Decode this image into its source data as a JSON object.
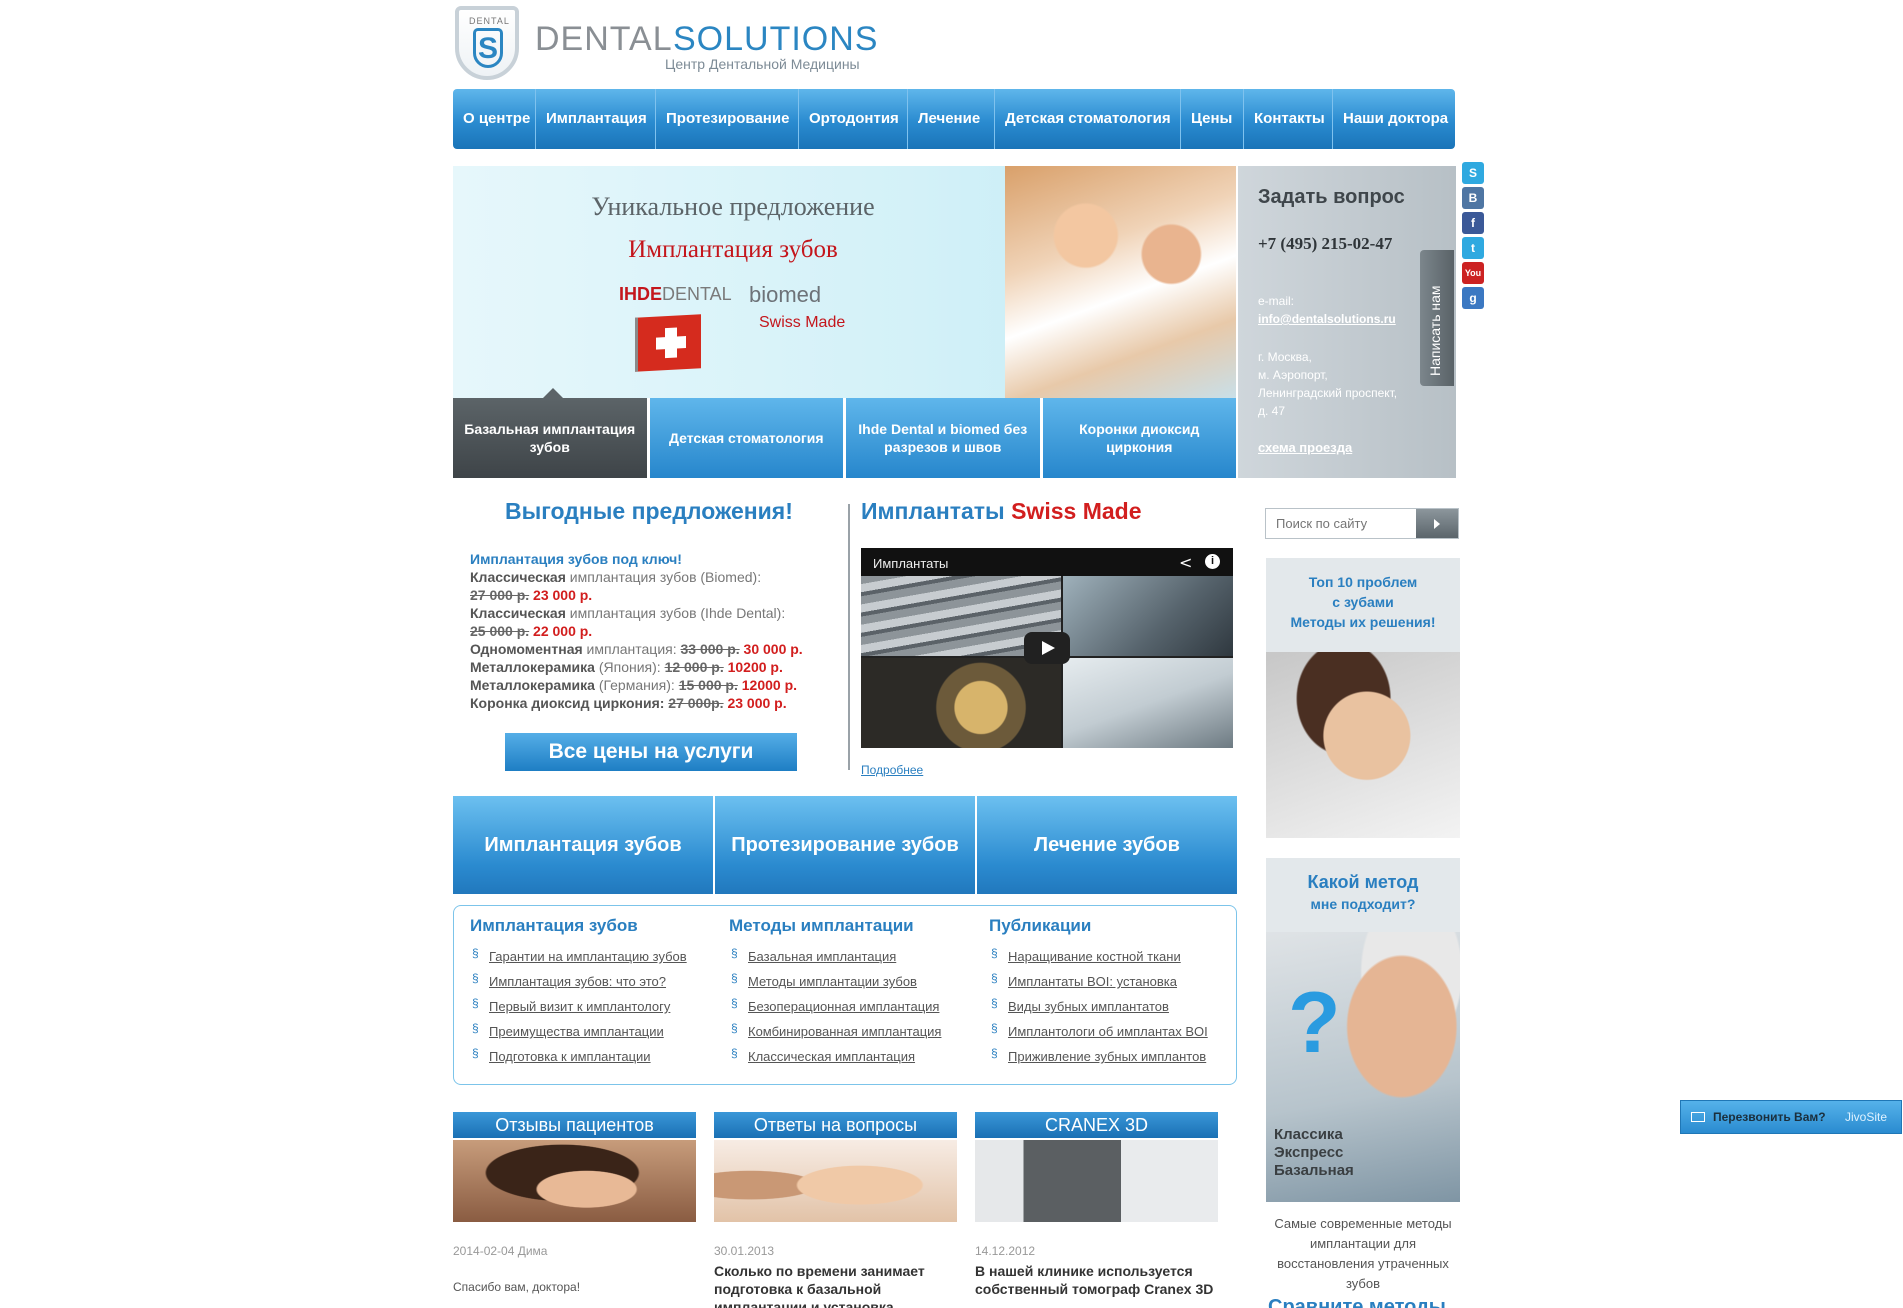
{
  "logo": {
    "small": "DENTAL",
    "letter": "S",
    "word1": "DENTAL",
    "word2": "SOLUTIONS",
    "tagline": "Центр Дентальной Медицины"
  },
  "nav": [
    "О центре",
    "Имплантация",
    "Протезирование",
    "Ортодонтия",
    "Лечение",
    "Детская стоматология",
    "Цены",
    "Контакты",
    "Наши доктора"
  ],
  "hero": {
    "headline": "Уникальное предложение",
    "subheadline": "Имплантация зубов",
    "brand1_a": "IHDE",
    "brand1_b": "DENTAL",
    "brand2": "biomed",
    "swiss": "Swiss Made",
    "tabs": [
      "Базальная имплантация зубов",
      "Детская стоматология",
      "Ihde Dental и biomed без разрезов и швов",
      "Коронки диоксид циркония"
    ]
  },
  "contact": {
    "title": "Задать вопрос",
    "phone": "+7 (495) 215-02-47",
    "email_label": "e-mail:",
    "email": "info@dentalsolutions.ru",
    "address": "г. Москва,\nм. Аэропорт,\nЛенинградский проспект,\nд. 47",
    "map_link": "схема проезда",
    "write_us": "Написать нам"
  },
  "social": [
    {
      "name": "skype-icon",
      "glyph": "S",
      "color": "#2fa9e0"
    },
    {
      "name": "vk-icon",
      "glyph": "В",
      "color": "#4f76a3"
    },
    {
      "name": "facebook-icon",
      "glyph": "f",
      "color": "#3b5998"
    },
    {
      "name": "twitter-icon",
      "glyph": "t",
      "color": "#2fa9e0"
    },
    {
      "name": "youtube-icon",
      "glyph": "You",
      "color": "#cc2222"
    },
    {
      "name": "google-icon",
      "glyph": "g",
      "color": "#3b78c2"
    }
  ],
  "offers": {
    "title": "Выгодные предложения!",
    "head": "Имплантация зубов под ключ!",
    "l1_b": "Классическая",
    "l1_t": " имплантация зубов (Biomed):",
    "l2_old": "27 000 р.",
    "l2_new": " 23 000 р.",
    "l3_b": "Классическая",
    "l3_t": " имплантация зубов (Ihde Dental):",
    "l4_old": "25 000 р.",
    "l4_new": " 22 000 р.",
    "l5_b": "Одномоментная",
    "l5_t": " имплантация: ",
    "l5_old": "33 000 р.",
    "l5_new": " 30 000 р.",
    "l6_b": "Металлокерамика",
    "l6_t": " (Япония): ",
    "l6_old": "12 000 р.",
    "l6_new": " 10200 р.",
    "l7_b": "Металлокерамика",
    "l7_t": " (Германия): ",
    "l7_old": "15 000 р.",
    "l7_new": " 12000 р.",
    "l8_b": "Коронка диоксид циркония: ",
    "l8_old": "27 000р.",
    "l8_new": " 23 000 р.",
    "button": "Все цены на услуги"
  },
  "implants": {
    "title_a": "Имплантаты ",
    "title_b": "Swiss Made",
    "video_title": "Имплантаты",
    "more": "Подробнее"
  },
  "big_buttons": [
    "Имплантация зубов",
    "Протезирование зубов",
    "Лечение зубов"
  ],
  "links": [
    {
      "title": "Имплантация зубов",
      "items": [
        "Гарантии на имплантацию зубов",
        "Имплантация зубов: что это?",
        "Первый визит к имплантологу",
        "Преимущества имплантации",
        "Подготовка к имплантации"
      ]
    },
    {
      "title": "Методы имплантации",
      "items": [
        "Базальная имплантация",
        "Методы имплантации зубов",
        "Безоперационная имплантация",
        "Комбинированная имплантация",
        "Классическая имплантация"
      ]
    },
    {
      "title": "Публикации",
      "items": [
        "Наращивание костной ткани",
        "Имплантаты BOI: установка",
        "Виды зубных имплантатов",
        "Имплантологи об имплантах BOI",
        "Приживление зубных имплантов"
      ]
    }
  ],
  "cards": [
    {
      "title": "Отзывы пациентов",
      "date": "2014-02-04 Дима",
      "text": "Спасибо вам, доктора!"
    },
    {
      "title": "Ответы на вопросы",
      "date": "30.01.2013",
      "text": "Сколько по времени занимает подготовка к базальной имплантации и установка"
    },
    {
      "title": "CRANEX 3D",
      "date": "14.12.2012",
      "text": "В нашей клинике используется собственный томограф Cranex 3D"
    }
  ],
  "search": {
    "placeholder": "Поиск по сайту"
  },
  "top10": {
    "text": "Топ 10 проблем\nс зубами\nМетоды их решения!"
  },
  "method": {
    "title": "Какой метод",
    "subtitle": "мне подходит?",
    "labels": "Классика\nЭкспресс\nБазальная",
    "desc": "Самые современные методы имплантации для восстановления утраченных зубов",
    "more": "Сравните методы"
  },
  "jivo": {
    "label": "Перезвонить Вам?",
    "brand": "JivoSite"
  }
}
